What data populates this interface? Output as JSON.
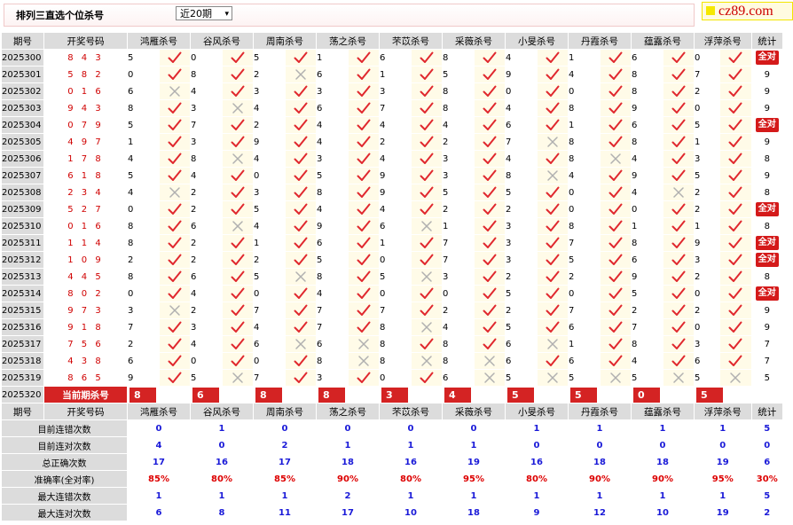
{
  "page_title": "排列三直选个位杀号",
  "period_select": {
    "value": "近20期",
    "arrow": "▾"
  },
  "logo": {
    "text": "cz89.com"
  },
  "columns": [
    "期号",
    "开奖号码",
    "鸿雁杀号",
    "谷风杀号",
    "周南杀号",
    "荡之杀号",
    "芣苡杀号",
    "采薇杀号",
    "小旻杀号",
    "丹霞杀号",
    "蕴露杀号",
    "浮萍杀号",
    "统计"
  ],
  "all_right_label": "全对",
  "rows": [
    {
      "p": "2025300",
      "n": "8 4 3",
      "k": [
        [
          "5",
          1
        ],
        [
          "0",
          1
        ],
        [
          "5",
          1
        ],
        [
          "1",
          1
        ],
        [
          "6",
          1
        ],
        [
          "8",
          1
        ],
        [
          "4",
          1
        ],
        [
          "1",
          1
        ],
        [
          "6",
          1
        ],
        [
          "0",
          1
        ]
      ],
      "t": "全对"
    },
    {
      "p": "2025301",
      "n": "5 8 2",
      "k": [
        [
          "0",
          1
        ],
        [
          "8",
          1
        ],
        [
          "2",
          0
        ],
        [
          "6",
          1
        ],
        [
          "1",
          1
        ],
        [
          "5",
          1
        ],
        [
          "9",
          1
        ],
        [
          "4",
          1
        ],
        [
          "8",
          1
        ],
        [
          "7",
          1
        ]
      ],
      "t": "9"
    },
    {
      "p": "2025302",
      "n": "0 1 6",
      "k": [
        [
          "6",
          0
        ],
        [
          "4",
          1
        ],
        [
          "3",
          1
        ],
        [
          "3",
          1
        ],
        [
          "3",
          1
        ],
        [
          "8",
          1
        ],
        [
          "0",
          1
        ],
        [
          "0",
          1
        ],
        [
          "8",
          1
        ],
        [
          "2",
          1
        ]
      ],
      "t": "9"
    },
    {
      "p": "2025303",
      "n": "9 4 3",
      "k": [
        [
          "8",
          1
        ],
        [
          "3",
          0
        ],
        [
          "4",
          1
        ],
        [
          "6",
          1
        ],
        [
          "7",
          1
        ],
        [
          "8",
          1
        ],
        [
          "4",
          1
        ],
        [
          "8",
          1
        ],
        [
          "9",
          1
        ],
        [
          "0",
          1
        ]
      ],
      "t": "9"
    },
    {
      "p": "2025304",
      "n": "0 7 9",
      "k": [
        [
          "5",
          1
        ],
        [
          "7",
          1
        ],
        [
          "2",
          1
        ],
        [
          "4",
          1
        ],
        [
          "4",
          1
        ],
        [
          "4",
          1
        ],
        [
          "6",
          1
        ],
        [
          "1",
          1
        ],
        [
          "6",
          1
        ],
        [
          "5",
          1
        ]
      ],
      "t": "全对"
    },
    {
      "p": "2025305",
      "n": "4 9 7",
      "k": [
        [
          "1",
          1
        ],
        [
          "3",
          1
        ],
        [
          "9",
          1
        ],
        [
          "4",
          1
        ],
        [
          "2",
          1
        ],
        [
          "2",
          1
        ],
        [
          "7",
          0
        ],
        [
          "8",
          1
        ],
        [
          "8",
          1
        ],
        [
          "1",
          1
        ]
      ],
      "t": "9"
    },
    {
      "p": "2025306",
      "n": "1 7 8",
      "k": [
        [
          "4",
          1
        ],
        [
          "8",
          0
        ],
        [
          "4",
          1
        ],
        [
          "3",
          1
        ],
        [
          "4",
          1
        ],
        [
          "3",
          1
        ],
        [
          "4",
          1
        ],
        [
          "8",
          0
        ],
        [
          "4",
          1
        ],
        [
          "3",
          1
        ]
      ],
      "t": "8"
    },
    {
      "p": "2025307",
      "n": "6 1 8",
      "k": [
        [
          "5",
          1
        ],
        [
          "4",
          1
        ],
        [
          "0",
          1
        ],
        [
          "5",
          1
        ],
        [
          "9",
          1
        ],
        [
          "3",
          1
        ],
        [
          "8",
          0
        ],
        [
          "4",
          1
        ],
        [
          "9",
          1
        ],
        [
          "5",
          1
        ]
      ],
      "t": "9"
    },
    {
      "p": "2025308",
      "n": "2 3 4",
      "k": [
        [
          "4",
          0
        ],
        [
          "2",
          1
        ],
        [
          "3",
          1
        ],
        [
          "8",
          1
        ],
        [
          "9",
          1
        ],
        [
          "5",
          1
        ],
        [
          "5",
          1
        ],
        [
          "0",
          1
        ],
        [
          "4",
          0
        ],
        [
          "2",
          1
        ]
      ],
      "t": "8"
    },
    {
      "p": "2025309",
      "n": "5 2 7",
      "k": [
        [
          "0",
          1
        ],
        [
          "2",
          1
        ],
        [
          "5",
          1
        ],
        [
          "4",
          1
        ],
        [
          "4",
          1
        ],
        [
          "2",
          1
        ],
        [
          "2",
          1
        ],
        [
          "0",
          1
        ],
        [
          "0",
          1
        ],
        [
          "2",
          1
        ]
      ],
      "t": "全对"
    },
    {
      "p": "2025310",
      "n": "0 1 6",
      "k": [
        [
          "8",
          1
        ],
        [
          "6",
          0
        ],
        [
          "4",
          1
        ],
        [
          "9",
          1
        ],
        [
          "6",
          0
        ],
        [
          "1",
          1
        ],
        [
          "3",
          1
        ],
        [
          "8",
          1
        ],
        [
          "1",
          1
        ],
        [
          "1",
          1
        ]
      ],
      "t": "8"
    },
    {
      "p": "2025311",
      "n": "1 1 4",
      "k": [
        [
          "8",
          1
        ],
        [
          "2",
          1
        ],
        [
          "1",
          1
        ],
        [
          "6",
          1
        ],
        [
          "1",
          1
        ],
        [
          "7",
          1
        ],
        [
          "3",
          1
        ],
        [
          "7",
          1
        ],
        [
          "8",
          1
        ],
        [
          "9",
          1
        ]
      ],
      "t": "全对"
    },
    {
      "p": "2025312",
      "n": "1 0 9",
      "k": [
        [
          "2",
          1
        ],
        [
          "2",
          1
        ],
        [
          "2",
          1
        ],
        [
          "5",
          1
        ],
        [
          "0",
          1
        ],
        [
          "7",
          1
        ],
        [
          "3",
          1
        ],
        [
          "5",
          1
        ],
        [
          "6",
          1
        ],
        [
          "3",
          1
        ]
      ],
      "t": "全对"
    },
    {
      "p": "2025313",
      "n": "4 4 5",
      "k": [
        [
          "8",
          1
        ],
        [
          "6",
          1
        ],
        [
          "5",
          0
        ],
        [
          "8",
          1
        ],
        [
          "5",
          0
        ],
        [
          "3",
          1
        ],
        [
          "2",
          1
        ],
        [
          "2",
          1
        ],
        [
          "9",
          1
        ],
        [
          "2",
          1
        ]
      ],
      "t": "8"
    },
    {
      "p": "2025314",
      "n": "8 0 2",
      "k": [
        [
          "0",
          1
        ],
        [
          "4",
          1
        ],
        [
          "0",
          1
        ],
        [
          "4",
          1
        ],
        [
          "0",
          1
        ],
        [
          "0",
          1
        ],
        [
          "5",
          1
        ],
        [
          "0",
          1
        ],
        [
          "5",
          1
        ],
        [
          "0",
          1
        ]
      ],
      "t": "全对"
    },
    {
      "p": "2025315",
      "n": "9 7 3",
      "k": [
        [
          "3",
          0
        ],
        [
          "2",
          1
        ],
        [
          "7",
          1
        ],
        [
          "7",
          1
        ],
        [
          "7",
          1
        ],
        [
          "2",
          1
        ],
        [
          "2",
          1
        ],
        [
          "7",
          1
        ],
        [
          "2",
          1
        ],
        [
          "2",
          1
        ]
      ],
      "t": "9"
    },
    {
      "p": "2025316",
      "n": "9 1 8",
      "k": [
        [
          "7",
          1
        ],
        [
          "3",
          1
        ],
        [
          "4",
          1
        ],
        [
          "7",
          1
        ],
        [
          "8",
          0
        ],
        [
          "4",
          1
        ],
        [
          "5",
          1
        ],
        [
          "6",
          1
        ],
        [
          "7",
          1
        ],
        [
          "0",
          1
        ]
      ],
      "t": "9"
    },
    {
      "p": "2025317",
      "n": "7 5 6",
      "k": [
        [
          "2",
          1
        ],
        [
          "4",
          1
        ],
        [
          "6",
          0
        ],
        [
          "6",
          0
        ],
        [
          "8",
          1
        ],
        [
          "8",
          1
        ],
        [
          "6",
          0
        ],
        [
          "1",
          1
        ],
        [
          "8",
          1
        ],
        [
          "3",
          1
        ]
      ],
      "t": "7"
    },
    {
      "p": "2025318",
      "n": "4 3 8",
      "k": [
        [
          "6",
          1
        ],
        [
          "0",
          1
        ],
        [
          "0",
          1
        ],
        [
          "8",
          0
        ],
        [
          "8",
          0
        ],
        [
          "8",
          0
        ],
        [
          "6",
          1
        ],
        [
          "6",
          1
        ],
        [
          "4",
          1
        ],
        [
          "6",
          1
        ]
      ],
      "t": "7"
    },
    {
      "p": "2025319",
      "n": "8 6 5",
      "k": [
        [
          "9",
          1
        ],
        [
          "5",
          0
        ],
        [
          "7",
          1
        ],
        [
          "3",
          1
        ],
        [
          "0",
          1
        ],
        [
          "6",
          0
        ],
        [
          "5",
          0
        ],
        [
          "5",
          0
        ],
        [
          "5",
          0
        ],
        [
          "5",
          0
        ]
      ],
      "t": "5"
    }
  ],
  "current": {
    "p": "2025320",
    "label": "当前期杀号",
    "k": [
      "8",
      "6",
      "8",
      "8",
      "3",
      "4",
      "5",
      "5",
      "0",
      "5"
    ]
  },
  "stats_header": [
    "期号",
    "开奖号码",
    "鸿雁杀号",
    "谷风杀号",
    "周南杀号",
    "荡之杀号",
    "芣苡杀号",
    "采薇杀号",
    "小旻杀号",
    "丹霞杀号",
    "蕴露杀号",
    "浮萍杀号",
    "统计"
  ],
  "stats": [
    {
      "label": "目前连错次数",
      "v": [
        "0",
        "1",
        "0",
        "0",
        "0",
        "0",
        "1",
        "1",
        "1",
        "1",
        "5"
      ]
    },
    {
      "label": "目前连对次数",
      "v": [
        "4",
        "0",
        "2",
        "1",
        "1",
        "1",
        "0",
        "0",
        "0",
        "0",
        "0"
      ]
    },
    {
      "label": "总正确次数",
      "v": [
        "17",
        "16",
        "17",
        "18",
        "16",
        "19",
        "16",
        "18",
        "18",
        "19",
        "6"
      ]
    },
    {
      "label": "准确率(全对率)",
      "v": [
        "85%",
        "80%",
        "85%",
        "90%",
        "80%",
        "95%",
        "80%",
        "90%",
        "90%",
        "95%",
        "30%"
      ],
      "pct": true
    },
    {
      "label": "最大连错次数",
      "v": [
        "1",
        "1",
        "1",
        "2",
        "1",
        "1",
        "1",
        "1",
        "1",
        "1",
        "5"
      ]
    },
    {
      "label": "最大连对次数",
      "v": [
        "6",
        "8",
        "11",
        "17",
        "10",
        "18",
        "9",
        "12",
        "10",
        "19",
        "2"
      ]
    }
  ],
  "colors": {
    "check": "#e0282e",
    "cross": "#b0b0b0",
    "kill_box": "#d42323",
    "stat_blue": "#1a1ad8",
    "stat_red": "#dd0000",
    "cell_yellow": "#fffbe8",
    "header_gray": "#dcdcdc"
  }
}
